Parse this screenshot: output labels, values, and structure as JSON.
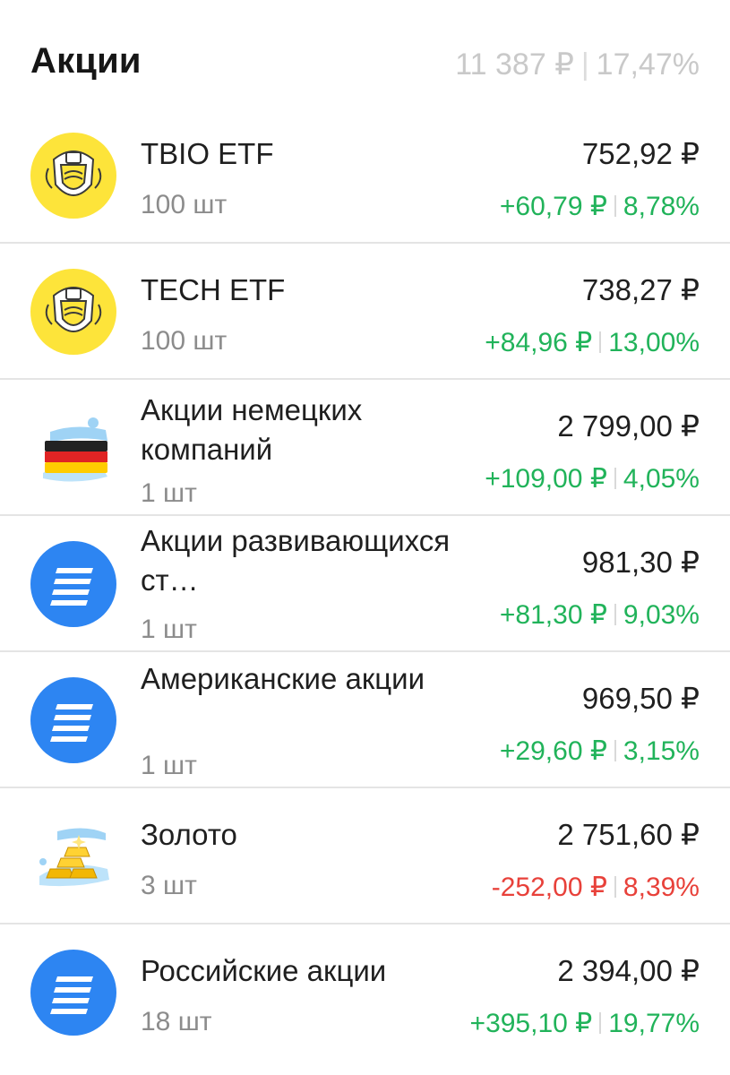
{
  "header": {
    "title": "Акции",
    "total": "11 387 ₽",
    "percent": "17,47%"
  },
  "colors": {
    "positive": "#21b35a",
    "negative": "#e8413a",
    "brand_yellow": "#fde43a",
    "blue_icon": "#2d85f2"
  },
  "items": [
    {
      "icon": "tinkoff-emblem-icon",
      "name": "TBIO ETF",
      "qty": "100 шт",
      "price": "752,92 ₽",
      "change": "+60,79 ₽",
      "change_pct": "8,78%",
      "direction": "positive"
    },
    {
      "icon": "tinkoff-emblem-icon",
      "name": "TECH ETF",
      "qty": "100 шт",
      "price": "738,27 ₽",
      "change": "+84,96 ₽",
      "change_pct": "13,00%",
      "direction": "positive"
    },
    {
      "icon": "german-flag-icon",
      "name": "Акции немецких компаний",
      "qty": "1 шт",
      "price": "2 799,00 ₽",
      "change": "+109,00 ₽",
      "change_pct": "4,05%",
      "direction": "positive"
    },
    {
      "icon": "lines-badge-icon",
      "name": "Акции развивающихся ст…",
      "qty": "1 шт",
      "price": "981,30 ₽",
      "change": "+81,30 ₽",
      "change_pct": "9,03%",
      "direction": "positive"
    },
    {
      "icon": "lines-badge-icon",
      "name": "Американские акции",
      "qty": "1 шт",
      "price": "969,50 ₽",
      "change": "+29,60 ₽",
      "change_pct": "3,15%",
      "direction": "positive"
    },
    {
      "icon": "gold-bars-icon",
      "name": "Золото",
      "qty": "3 шт",
      "price": "2 751,60 ₽",
      "change": "-252,00 ₽",
      "change_pct": "8,39%",
      "direction": "negative"
    },
    {
      "icon": "lines-badge-icon",
      "name": "Российские акции",
      "qty": "18 шт",
      "price": "2 394,00 ₽",
      "change": "+395,10 ₽",
      "change_pct": "19,77%",
      "direction": "positive"
    }
  ]
}
